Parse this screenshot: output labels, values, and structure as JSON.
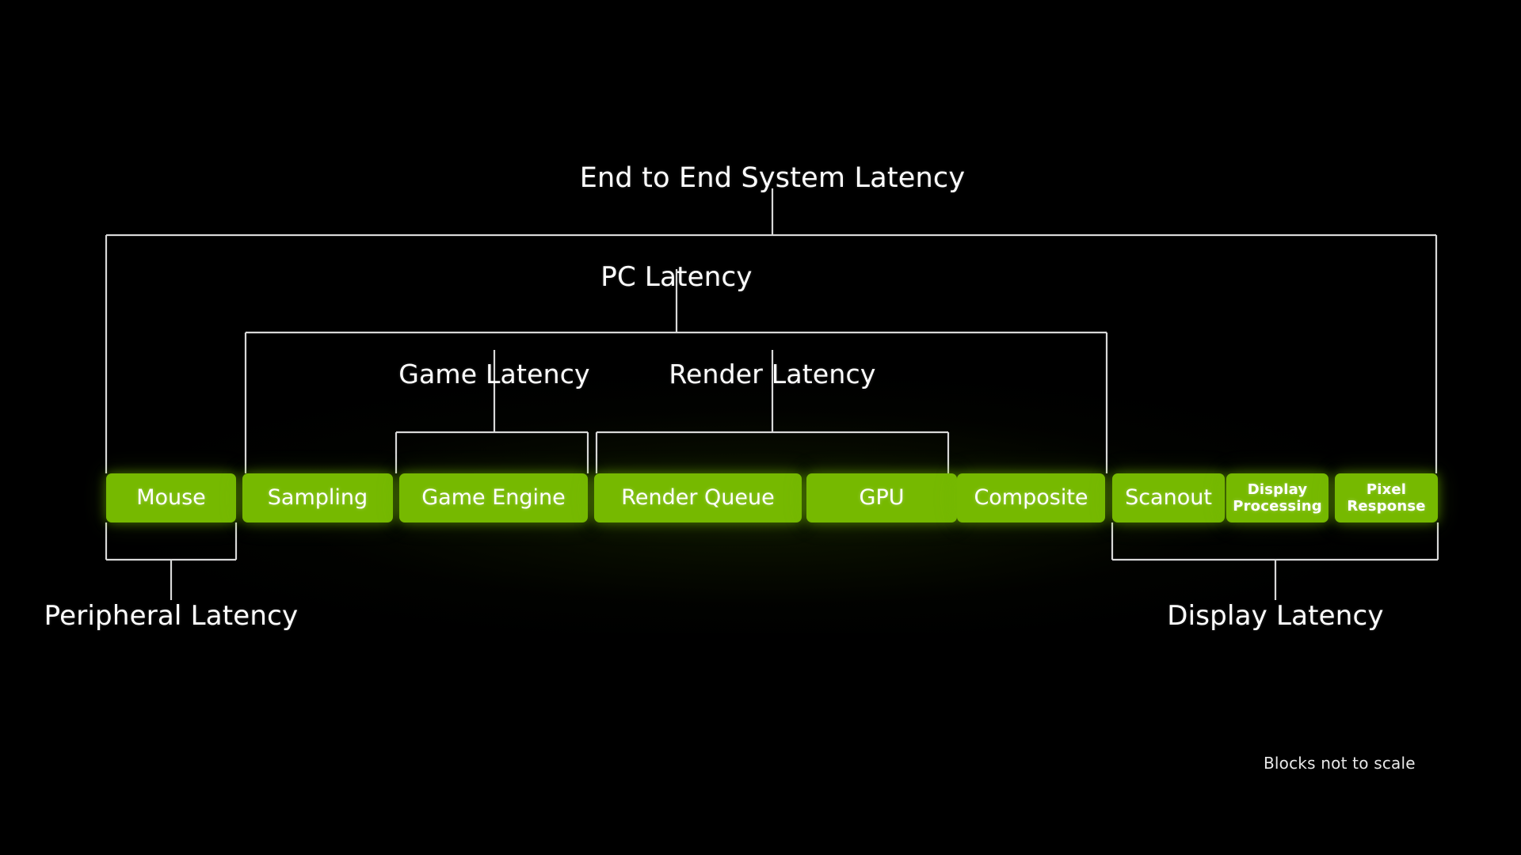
{
  "diagram": {
    "title": "End to End System Latency",
    "footnote": "Blocks not to scale",
    "accent_color": "#76b900",
    "line_color": "#d8d8d8",
    "background_color": "#000000",
    "groups": [
      {
        "id": "end-to-end",
        "label": "End to End System Latency",
        "spans": [
          "Mouse",
          "Sampling",
          "Game Engine",
          "Render Queue",
          "GPU",
          "Composite",
          "Scanout",
          "Display Processing",
          "Pixel Response"
        ]
      },
      {
        "id": "pc-latency",
        "label": "PC Latency",
        "spans": [
          "Sampling",
          "Game Engine",
          "Render Queue",
          "GPU",
          "Composite",
          "Scanout"
        ]
      },
      {
        "id": "game-latency",
        "label": "Game Latency",
        "spans": [
          "Game Engine"
        ]
      },
      {
        "id": "render-latency",
        "label": "Render Latency",
        "spans": [
          "Render Queue",
          "GPU",
          "Composite"
        ]
      },
      {
        "id": "peripheral-latency",
        "label": "Peripheral Latency",
        "spans": [
          "Mouse"
        ]
      },
      {
        "id": "display-latency",
        "label": "Display Latency",
        "spans": [
          "Scanout",
          "Display Processing",
          "Pixel Response"
        ]
      }
    ],
    "blocks": [
      {
        "id": "mouse",
        "label": "Mouse",
        "size": "large"
      },
      {
        "id": "sampling",
        "label": "Sampling",
        "size": "large"
      },
      {
        "id": "game-engine",
        "label": "Game Engine",
        "size": "large"
      },
      {
        "id": "render-queue",
        "label": "Render Queue",
        "size": "large"
      },
      {
        "id": "gpu",
        "label": "GPU",
        "size": "large"
      },
      {
        "id": "composite",
        "label": "Composite",
        "size": "large"
      },
      {
        "id": "scanout",
        "label": "Scanout",
        "size": "large"
      },
      {
        "id": "display-processing",
        "label": "Display\nProcessing",
        "size": "small"
      },
      {
        "id": "pixel-response",
        "label": "Pixel\nResponse",
        "size": "small"
      }
    ]
  }
}
